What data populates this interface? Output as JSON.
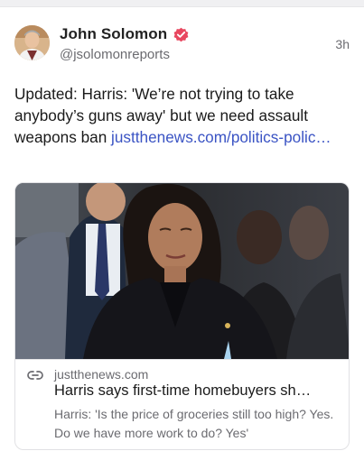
{
  "post": {
    "author_name": "John Solomon",
    "author_handle": "@jsolomonreports",
    "timestamp": "3h",
    "text": "Updated: Harris: 'We’re not trying to take anybody’s guns away' but we need assault weapons ban ",
    "link_text": "justthenews.com/politics-polic…",
    "verified_color": "#e8475f"
  },
  "embed": {
    "domain": "justthenews.com",
    "title": "Harris says first-time homebuyers sh…",
    "description": "Harris: 'Is the price of groceries still too high? Yes. Do we have more work to do? Yes'"
  },
  "icons": {
    "verified": "verified-badge-icon",
    "link": "link-icon"
  }
}
